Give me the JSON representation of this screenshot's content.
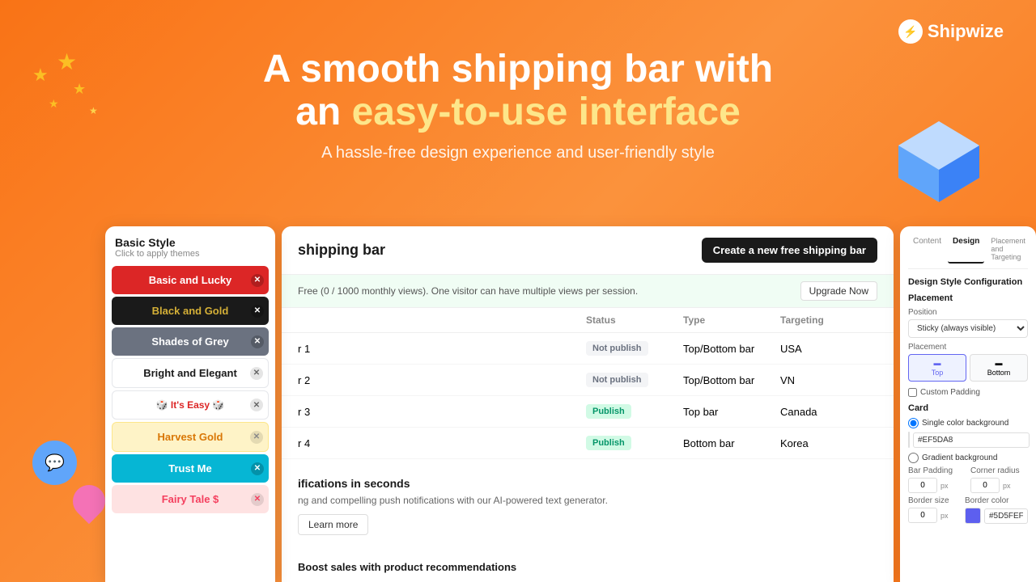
{
  "logo": {
    "icon": "⚡",
    "name": "Shipwize"
  },
  "hero": {
    "title_part1": "A smooth shipping bar with",
    "title_part2": "an ",
    "title_accent": "easy-to-use interface",
    "subtitle": "A hassle-free design experience and user-friendly style"
  },
  "style_panel": {
    "title": "Basic Style",
    "subtitle": "Click to apply themes",
    "themes": [
      {
        "id": "basic-lucky",
        "label": "Basic and Lucky",
        "class": "theme-basic-lucky"
      },
      {
        "id": "black-gold",
        "label": "Black and Gold",
        "class": "theme-black-gold"
      },
      {
        "id": "shades-grey",
        "label": "Shades of Grey",
        "class": "theme-shades-grey"
      },
      {
        "id": "bright-elegant",
        "label": "Bright and Elegant",
        "class": "theme-bright-elegant"
      },
      {
        "id": "its-easy",
        "label": "🎲 It's Easy 🎲",
        "class": "theme-its-easy"
      },
      {
        "id": "harvest-gold",
        "label": "Harvest Gold",
        "class": "theme-harvest-gold"
      },
      {
        "id": "trust-me",
        "label": "Trust Me",
        "class": "theme-trust-me"
      },
      {
        "id": "fairy-tale",
        "label": "Fairy Tale $",
        "class": "theme-fairy-tale"
      }
    ]
  },
  "dashboard": {
    "title": "shipping bar",
    "free_notice": "Free (0 / 1000 monthly views). One visitor can have multiple views per session.",
    "create_btn": "Create a new free shipping bar",
    "upgrade_btn": "Upgrade Now",
    "columns": [
      "",
      "Status",
      "Type",
      "Targeting"
    ],
    "rows": [
      {
        "name": "r 1",
        "status": "Not publish",
        "type": "Top/Bottom bar",
        "targeting": "USA",
        "published": false
      },
      {
        "name": "r 2",
        "status": "Not publish",
        "type": "Top/Bottom bar",
        "targeting": "VN",
        "published": false
      },
      {
        "name": "r 3",
        "status": "Publish",
        "type": "Top bar",
        "targeting": "Canada",
        "published": true
      },
      {
        "name": "r 4",
        "status": "Publish",
        "type": "Bottom bar",
        "targeting": "Korea",
        "published": true
      }
    ],
    "info_section_title": "ifications in seconds",
    "info_section_text": "ng and compelling push notifications with our AI-powered text generator.",
    "learn_more": "Learn more",
    "boost_title": "Boost sales with product recommendations"
  },
  "design_panel": {
    "tabs": [
      "Content",
      "Design",
      "Placement and Targeting"
    ],
    "active_tab": "Design",
    "section_title": "Design Style Configuration",
    "placement": {
      "label": "Placement",
      "position_label": "Position",
      "position_value": "Sticky (always visible)",
      "placement_label": "Placement",
      "top": "Top",
      "bottom": "Bottom",
      "custom_padding": "Custom Padding"
    },
    "card": {
      "label": "Card",
      "single_color": "Single color background",
      "color_value": "#EF5DA8",
      "color_hex": "#EF5DA8",
      "gradient": "Gradient background",
      "bar_padding": "Bar Padding",
      "corner_radius": "Corner radius",
      "padding_val": "0",
      "radius_val": "0",
      "border_size": "Border size",
      "border_color": "Border color",
      "border_size_val": "0",
      "border_color_val": "#5D5FEF"
    }
  }
}
